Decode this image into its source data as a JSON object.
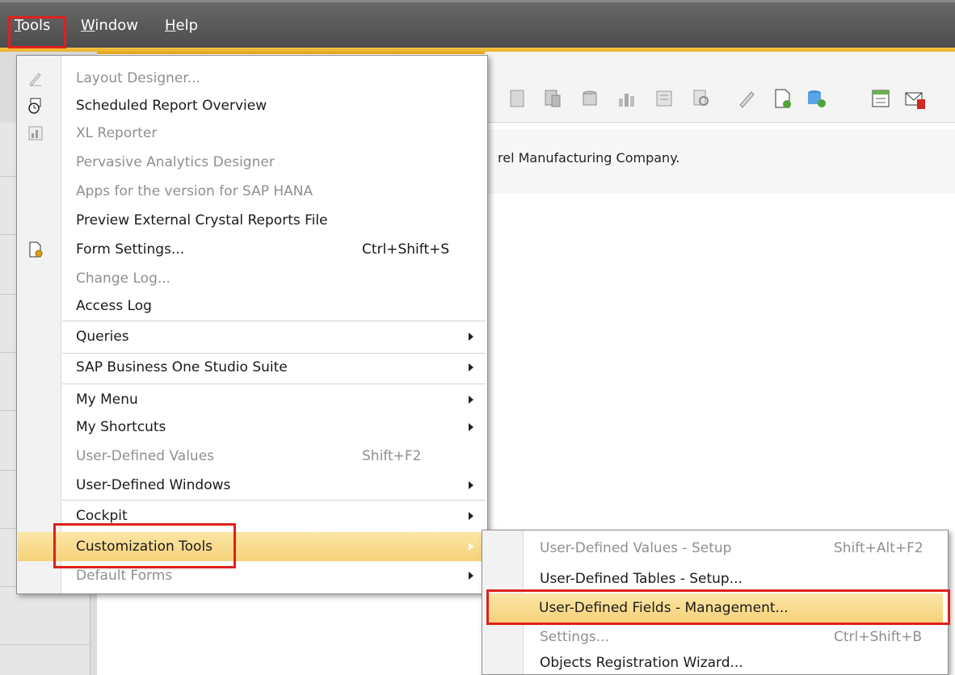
{
  "menubar": {
    "items": [
      {
        "label": "Tools",
        "mnemonic": "T",
        "rest": "ools"
      },
      {
        "label": "Window",
        "mnemonic": "W",
        "rest": "indow"
      },
      {
        "label": "Help",
        "mnemonic": "H",
        "rest": "elp"
      }
    ],
    "accent_color": "#f0b429"
  },
  "background": {
    "company_message": "rel Manufacturing Company."
  },
  "tools_menu": {
    "items": [
      {
        "label": "Layout Designer...",
        "disabled": true,
        "icon": "pencil-icon"
      },
      {
        "label": "Scheduled Report Overview",
        "disabled": false,
        "icon": "report-clock-icon"
      },
      {
        "label": "XL Reporter",
        "disabled": true,
        "icon": "spreadsheet-icon"
      },
      {
        "label": "Pervasive Analytics Designer",
        "disabled": true
      },
      {
        "label": "Apps for the version for SAP HANA",
        "disabled": true
      },
      {
        "label": "Preview External Crystal Reports File",
        "disabled": false
      },
      {
        "label": "Form Settings...",
        "shortcut": "Ctrl+Shift+S",
        "disabled": false,
        "icon": "form-settings-icon"
      },
      {
        "label": "Change Log...",
        "disabled": true
      },
      {
        "label": "Access Log",
        "disabled": false
      },
      {
        "label": "Queries",
        "submenu": true,
        "disabled": false
      },
      {
        "label": "SAP Business One Studio Suite",
        "submenu": true,
        "disabled": false
      },
      {
        "label": "My Menu",
        "submenu": true,
        "disabled": false
      },
      {
        "label": "My Shortcuts",
        "submenu": true,
        "disabled": false
      },
      {
        "label": "User-Defined Values",
        "shortcut": "Shift+F2",
        "disabled": true
      },
      {
        "label": "User-Defined Windows",
        "submenu": true,
        "disabled": false
      },
      {
        "label": "Cockpit",
        "submenu": true,
        "disabled": false
      },
      {
        "label": "Customization Tools",
        "submenu": true,
        "disabled": false,
        "highlighted": true
      },
      {
        "label": "Default Forms",
        "submenu": true,
        "disabled": true
      }
    ]
  },
  "customization_submenu": {
    "items": [
      {
        "label": "User-Defined Values - Setup",
        "shortcut": "Shift+Alt+F2",
        "disabled": true
      },
      {
        "label": "User-Defined Tables - Setup...",
        "disabled": false
      },
      {
        "label": "User-Defined Fields - Management...",
        "disabled": false,
        "highlighted": true
      },
      {
        "label": "Settings...",
        "shortcut": "Ctrl+Shift+B",
        "disabled": true
      },
      {
        "label": "Objects Registration Wizard...",
        "disabled": false
      }
    ]
  }
}
